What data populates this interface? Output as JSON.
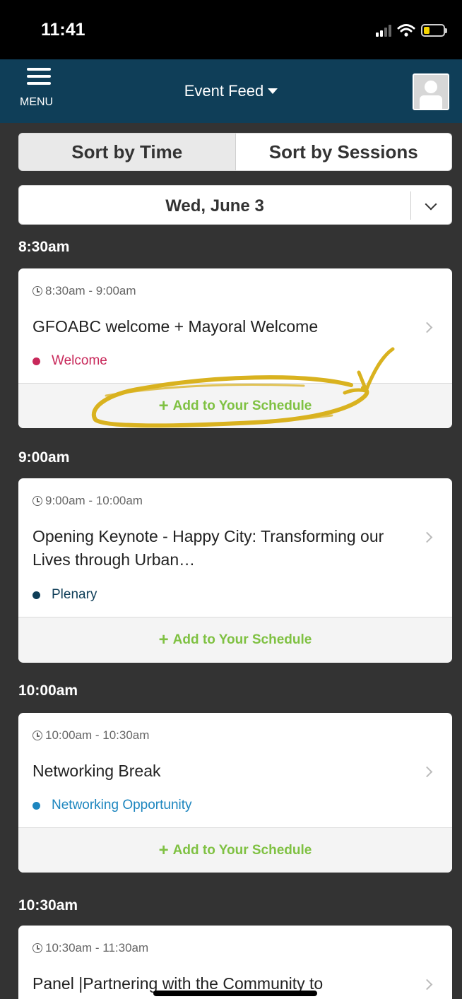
{
  "status": {
    "time": "11:41"
  },
  "nav": {
    "menu_label": "MENU",
    "title": "Event Feed"
  },
  "sort": {
    "by_time": "Sort by Time",
    "by_sessions": "Sort by Sessions"
  },
  "date": {
    "selected": "Wed, June 3"
  },
  "add_label": "Add to Your Schedule",
  "groups": [
    {
      "header": "8:30am",
      "time": "8:30am - 9:00am",
      "title": "GFOABC welcome + Mayoral Welcome",
      "tag": "Welcome",
      "tag_color": "#c8285a"
    },
    {
      "header": "9:00am",
      "time": "9:00am - 10:00am",
      "title": "Opening Keynote - Happy City: Transforming our Lives through Urban…",
      "tag": "Plenary",
      "tag_color": "#0f3e58"
    },
    {
      "header": "10:00am",
      "time": "10:00am - 10:30am",
      "title": "Networking Break",
      "tag": "Networking Opportunity",
      "tag_color": "#1d86bf"
    },
    {
      "header": "10:30am",
      "time": "10:30am - 11:30am",
      "title": "Panel |Partnering with the Community to"
    }
  ],
  "colors": {
    "nav": "#0f3e58",
    "add": "#7fc142",
    "annotation": "#d9b21f"
  }
}
